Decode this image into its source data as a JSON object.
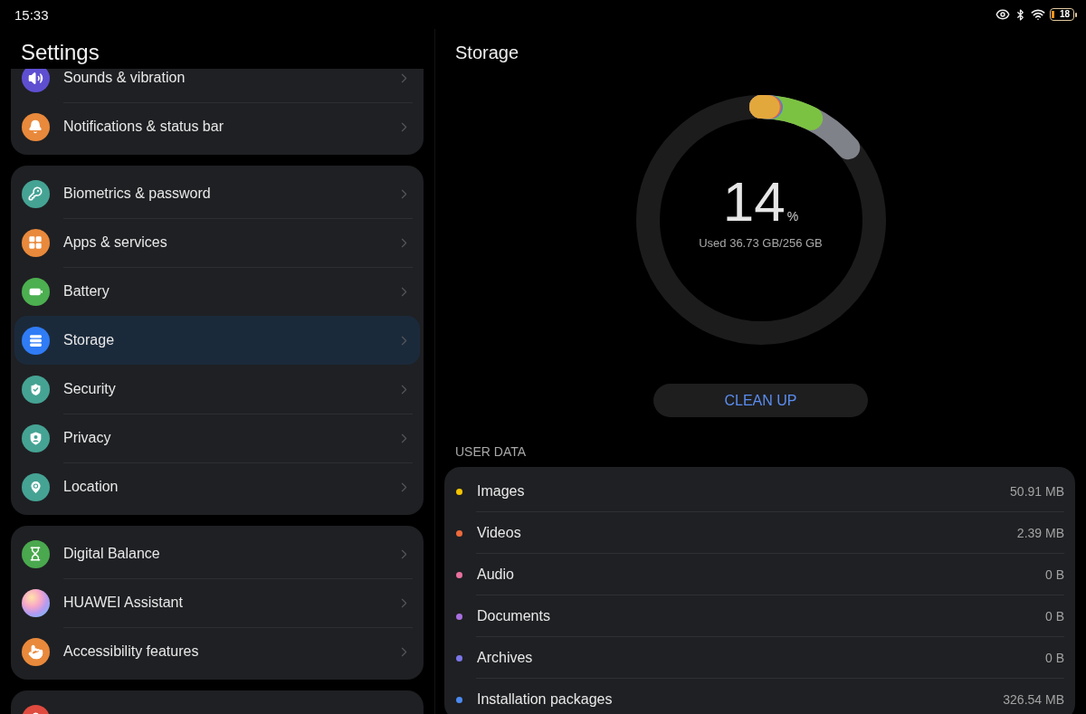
{
  "status_bar": {
    "time": "15:33",
    "battery": "18"
  },
  "sidebar": {
    "title": "Settings",
    "groups": [
      {
        "items": [
          {
            "label": "Sounds & vibration",
            "selected": false
          },
          {
            "label": "Notifications & status bar",
            "selected": false
          }
        ]
      },
      {
        "items": [
          {
            "label": "Biometrics & password",
            "selected": false
          },
          {
            "label": "Apps & services",
            "selected": false
          },
          {
            "label": "Battery",
            "selected": false
          },
          {
            "label": "Storage",
            "selected": true
          },
          {
            "label": "Security",
            "selected": false
          },
          {
            "label": "Privacy",
            "selected": false
          },
          {
            "label": "Location",
            "selected": false
          }
        ]
      },
      {
        "items": [
          {
            "label": "Digital Balance",
            "selected": false
          },
          {
            "label": "HUAWEI Assistant",
            "selected": false
          },
          {
            "label": "Accessibility features",
            "selected": false
          }
        ]
      },
      {
        "items": [
          {
            "selected": false
          }
        ]
      }
    ]
  },
  "detail": {
    "title": "Storage",
    "usage": {
      "percent": "14",
      "unit": "%",
      "summary": "Used 36.73 GB/256 GB"
    },
    "clean_button": "CLEAN UP",
    "section_label": "USER DATA",
    "categories": [
      {
        "label": "Images",
        "size": "50.91 MB",
        "color": "#f5c400"
      },
      {
        "label": "Videos",
        "size": "2.39 MB",
        "color": "#ee6a3c"
      },
      {
        "label": "Audio",
        "size": "0 B",
        "color": "#e8709f"
      },
      {
        "label": "Documents",
        "size": "0 B",
        "color": "#a86ee0"
      },
      {
        "label": "Archives",
        "size": "0 B",
        "color": "#7b76ea"
      },
      {
        "label": "Installation packages",
        "size": "326.54 MB",
        "color": "#4b8af2"
      }
    ]
  }
}
